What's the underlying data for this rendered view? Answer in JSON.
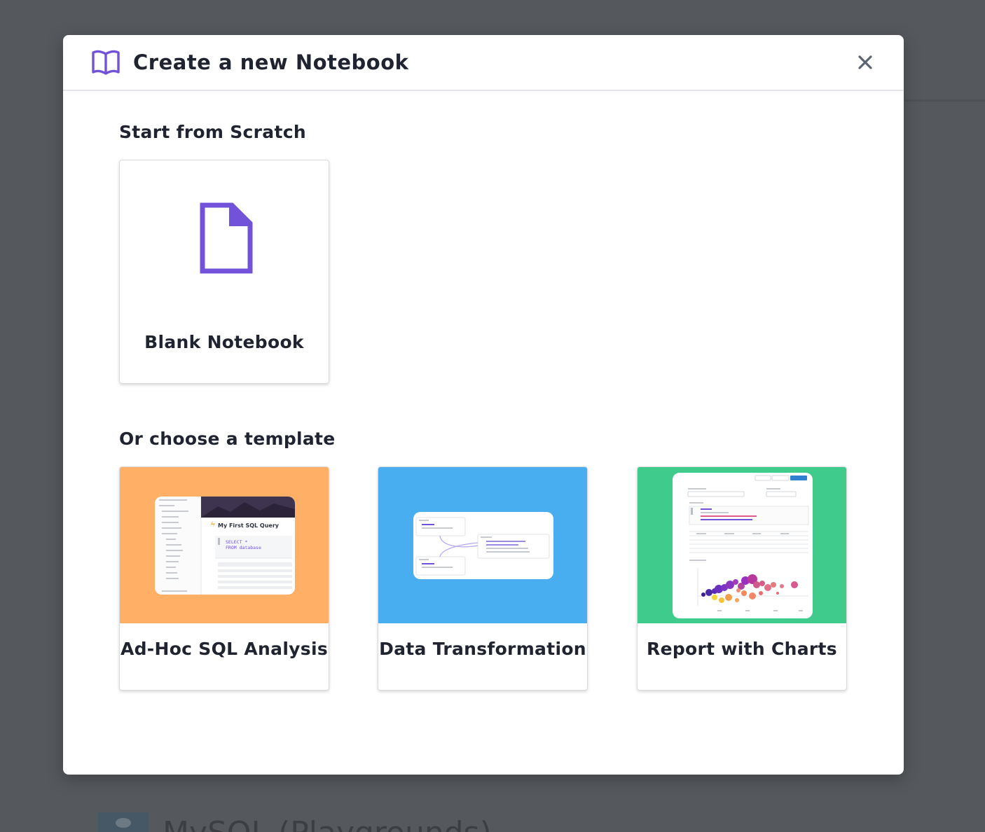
{
  "modal": {
    "title": "Create a new Notebook",
    "icons": {
      "header": "book-open-icon",
      "close": "close-icon"
    }
  },
  "scratch": {
    "heading": "Start from Scratch",
    "blank_label": "Blank Notebook",
    "icon": "document-icon"
  },
  "templates": {
    "heading": "Or choose a template",
    "items": [
      {
        "label": "Ad-Hoc SQL Analysis",
        "color": "#ffb066"
      },
      {
        "label": "Data Transformation",
        "color": "#48aef0"
      },
      {
        "label": "Report with Charts",
        "color": "#3ecb8c"
      }
    ]
  },
  "preview_sql": {
    "title": "My First SQL Query",
    "line1": "SELECT *",
    "line2": "FROM database"
  },
  "background": {
    "text": "MySQL (Playgrounds)"
  },
  "colors": {
    "accent": "#7152d8",
    "title_text": "#1f2430",
    "close_icon": "#5a6472"
  }
}
